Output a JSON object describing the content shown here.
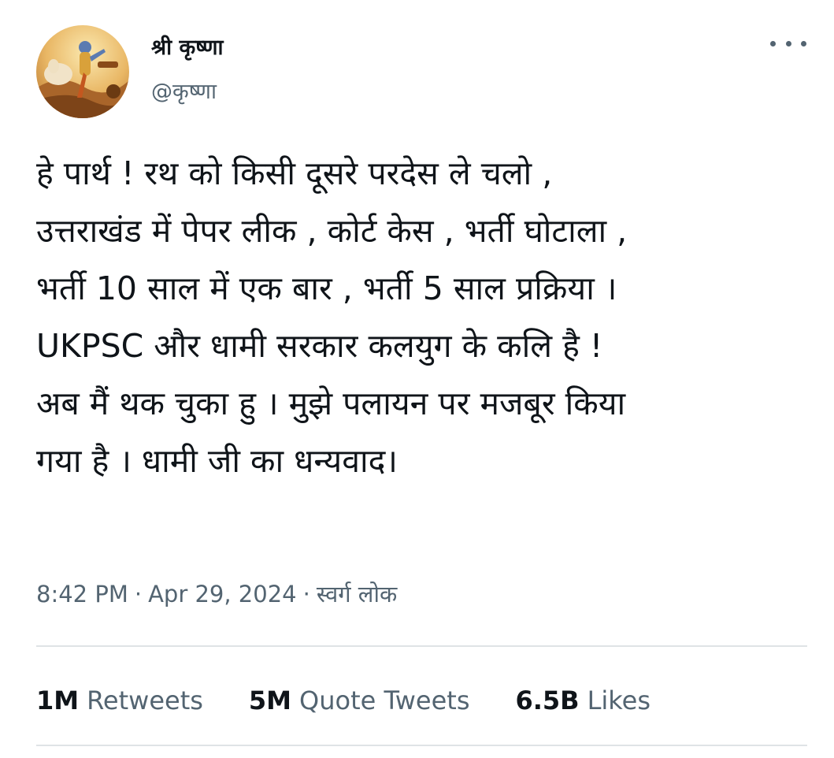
{
  "author": {
    "display_name": "श्री कृष्णा",
    "handle": "@कृष्णा"
  },
  "tweet": {
    "lines": [
      "हे पार्थ ! रथ को किसी दूसरे परदेस ले चलो ,",
      "उत्तराखंड में पेपर लीक , कोर्ट केस , भर्ती घोटाला ,",
      "भर्ती 10 साल में एक बार , भर्ती 5 साल प्रक्रिया ।",
      "UKPSC और धामी सरकार कलयुग के कलि है !",
      "अब मैं थक चुका हु । मुझे पलायन पर मजबूर किया",
      "गया है । धामी जी का धन्यवाद।"
    ]
  },
  "meta": {
    "time": "8:42 PM",
    "separator": "·",
    "date": "Apr 29, 2024",
    "location": "स्वर्ग लोक"
  },
  "stats": {
    "retweets": {
      "count": "1M",
      "label": "Retweets"
    },
    "quotes": {
      "count": "5M",
      "label": "Quote Tweets"
    },
    "likes": {
      "count": "6.5B",
      "label": "Likes"
    }
  },
  "colors": {
    "text_primary": "#0f1419",
    "text_secondary": "#536471",
    "divider": "#dfe3e6"
  },
  "icons": {
    "more": "more-horizontal-icon"
  }
}
